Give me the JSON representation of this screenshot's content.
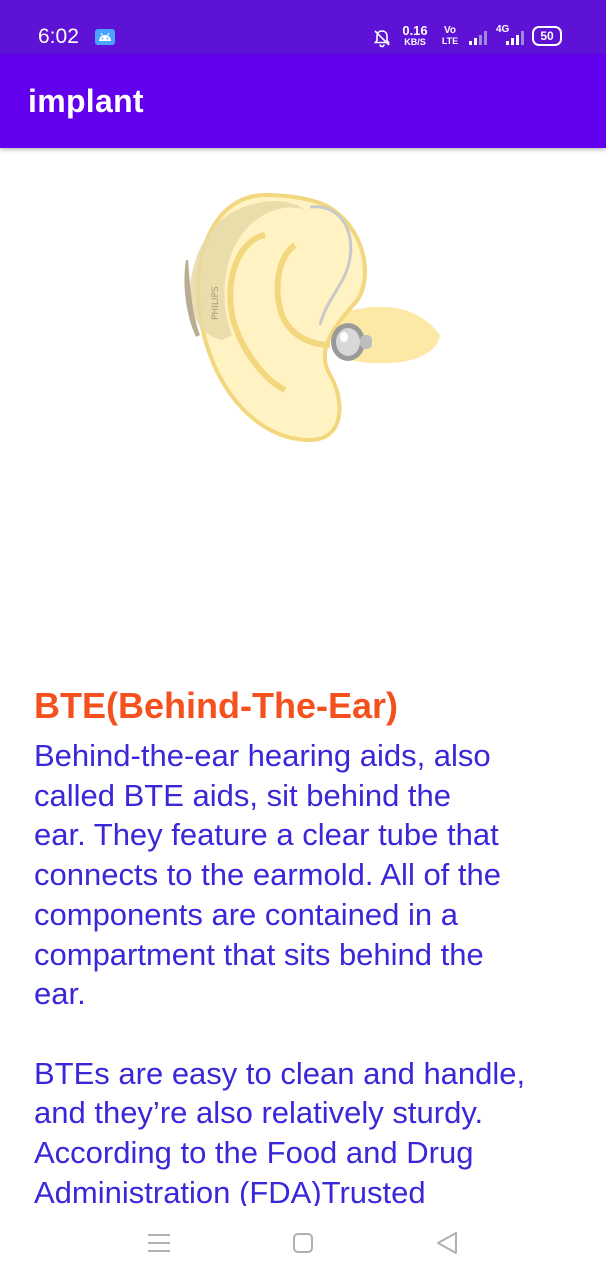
{
  "status_bar": {
    "time": "6:02",
    "net_speed_value": "0.16",
    "net_speed_unit": "KB/S",
    "volte_top": "Vo",
    "volte_bottom": "LTE",
    "network_type": "4G",
    "battery": "50",
    "icons": [
      "android-icon",
      "bell-muted-icon",
      "signal-icon",
      "signal-icon",
      "battery-icon"
    ],
    "color": "#5d12d6"
  },
  "app_bar": {
    "title": "implant",
    "color": "#6200ee"
  },
  "hero_image": {
    "brand_text": "PHILIPS"
  },
  "content": {
    "title": "BTE(Behind-The-Ear)",
    "title_color": "#f4511e",
    "body": "Behind-the-ear hearing aids, also\ncalled BTE aids, sit behind the\near. They feature a clear tube that\nconnects to the earmold. All of the\ncomponents are contained in a\ncompartment that sits behind the\near.\n\nBTEs are easy to clean and handle,\nand they’re also relatively sturdy.\nAccording to the Food and Drug\nAdministration (FDA)Trusted",
    "body_color": "#3a27d8"
  },
  "nav_bar": {
    "icons": [
      "menu-icon",
      "home-icon",
      "back-icon"
    ]
  }
}
